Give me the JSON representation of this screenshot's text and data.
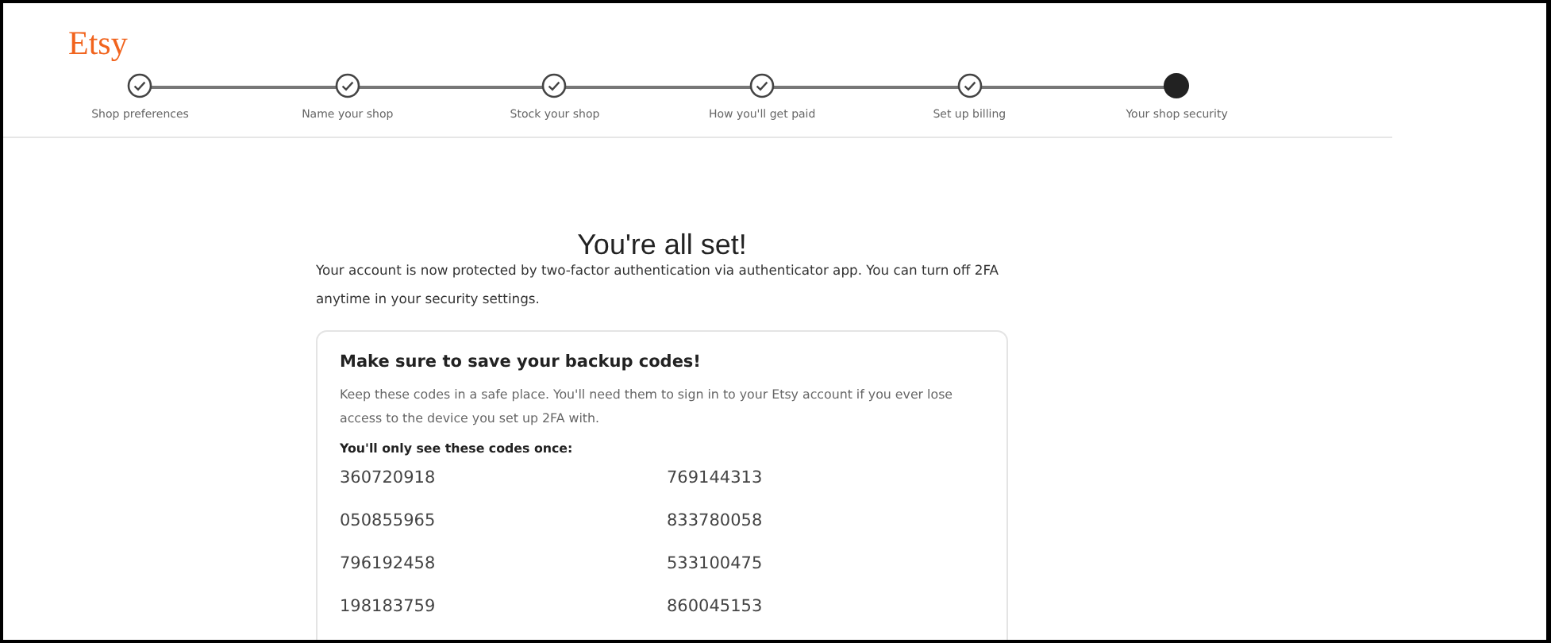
{
  "logo": "Etsy",
  "steps": [
    {
      "label": "Shop preferences",
      "completed": true
    },
    {
      "label": "Name your shop",
      "completed": true
    },
    {
      "label": "Stock your shop",
      "completed": true
    },
    {
      "label": "How you'll get paid",
      "completed": true
    },
    {
      "label": "Set up billing",
      "completed": true
    },
    {
      "label": "Your shop security",
      "completed": false
    }
  ],
  "title": "You're all set!",
  "message": "Your account is now protected by two-factor authentication via authenticator app. You can turn off 2FA anytime in your security settings.",
  "card": {
    "heading": "Make sure to save your backup codes!",
    "text": "Keep these codes in a safe place. You'll need them to sign in to your Etsy account if you ever lose access to the device you set up 2FA with.",
    "note": "You'll only see these codes once:",
    "codes": [
      "360720918",
      "769144313",
      "050855965",
      "833780058",
      "796192458",
      "533100475",
      "198183759",
      "860045153"
    ]
  }
}
